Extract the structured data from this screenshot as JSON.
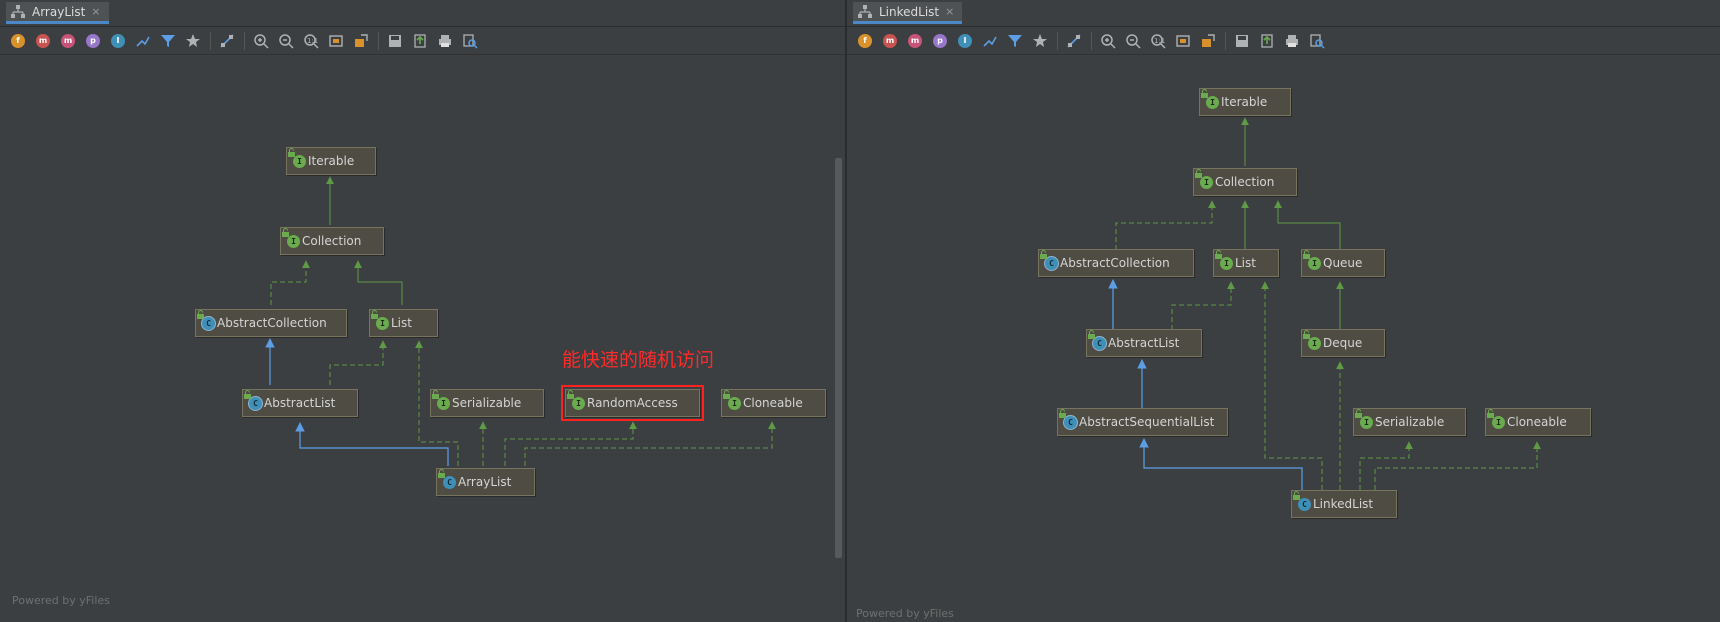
{
  "left_panel": {
    "tab": {
      "label": "ArrayList",
      "close": "×"
    },
    "annotation": "能快速的随机访问",
    "powered_by": "Powered by yFiles",
    "nodes": {
      "iterable": "Iterable",
      "collection": "Collection",
      "abstract_collection": "AbstractCollection",
      "list": "List",
      "abstract_list": "AbstractList",
      "serializable": "Serializable",
      "random_access": "RandomAccess",
      "cloneable": "Cloneable",
      "array_list": "ArrayList"
    }
  },
  "right_panel": {
    "tab": {
      "label": "LinkedList",
      "close": "×"
    },
    "powered_by": "Powered by yFiles",
    "nodes": {
      "iterable": "Iterable",
      "collection": "Collection",
      "abstract_collection": "AbstractCollection",
      "list": "List",
      "queue": "Queue",
      "abstract_list": "AbstractList",
      "deque": "Deque",
      "abstract_sequential_list": "AbstractSequentialList",
      "serializable": "Serializable",
      "cloneable": "Cloneable",
      "linked_list": "LinkedList"
    }
  },
  "kind_badges": {
    "interface": "I",
    "class": "C"
  },
  "toolbar_icons": [
    "fields-icon",
    "constructors-icon",
    "methods-icon",
    "properties-icon",
    "inner-classes-icon",
    "edge-filter-icon",
    "filter-icon",
    "pin-icon",
    "layout-icon",
    "zoom-in-icon",
    "zoom-out-icon",
    "actual-size-icon",
    "fit-content-icon",
    "export-icon",
    "save-icon",
    "open-icon",
    "print-icon",
    "print-preview-icon"
  ],
  "colors": {
    "background": "#3c3f41",
    "node_fill": "#4f4c43",
    "interface_green": "#6aab4f",
    "class_blue": "#3f8fb7",
    "implements_edge": "#5f9a46",
    "extends_edge": "#5c9ee6",
    "annotation_red": "#ff2a2a"
  }
}
